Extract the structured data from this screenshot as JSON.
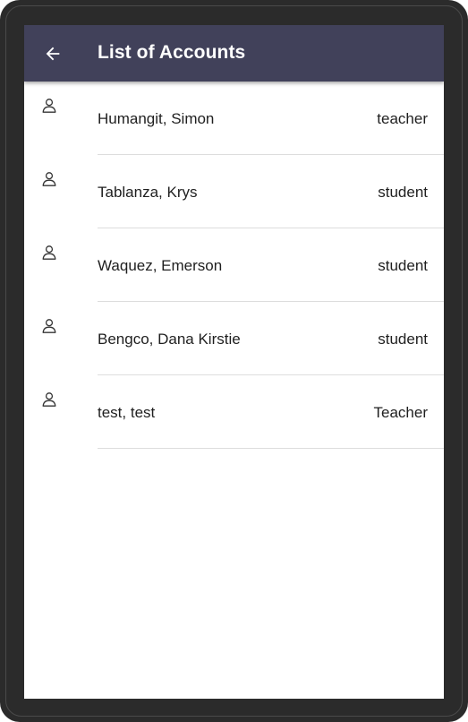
{
  "appbar": {
    "title": "List of Accounts",
    "back_icon": "arrow-left-icon"
  },
  "accounts": [
    {
      "name": "Humangit, Simon",
      "role": "teacher",
      "icon": "person-icon"
    },
    {
      "name": "Tablanza, Krys",
      "role": "student",
      "icon": "person-icon"
    },
    {
      "name": "Waquez, Emerson",
      "role": "student",
      "icon": "person-icon"
    },
    {
      "name": "Bengco, Dana Kirstie",
      "role": "student",
      "icon": "person-icon"
    },
    {
      "name": "test, test",
      "role": "Teacher",
      "icon": "person-icon"
    }
  ],
  "colors": {
    "appbar_background": "#41415a",
    "device_frame": "#2b2b2b",
    "text": "#1f1f1f",
    "divider": "#dddddd"
  }
}
